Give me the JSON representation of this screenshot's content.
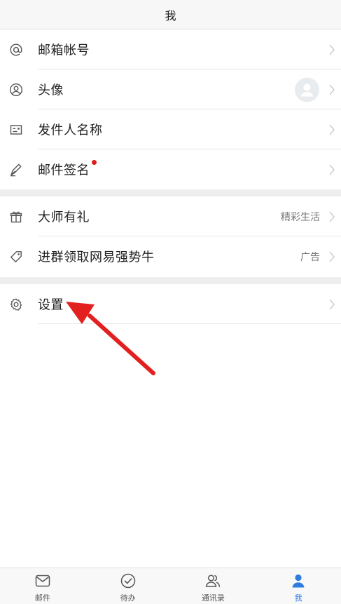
{
  "header": {
    "title": "我"
  },
  "groups": [
    {
      "items": [
        {
          "label": "邮箱帐号",
          "icon": "at-icon"
        },
        {
          "label": "头像",
          "icon": "user-circle-icon"
        },
        {
          "label": "发件人名称",
          "icon": "id-card-icon"
        },
        {
          "label": "邮件签名",
          "icon": "pen-icon",
          "badge": true
        }
      ]
    },
    {
      "items": [
        {
          "label": "大师有礼",
          "icon": "gift-icon",
          "value": "精彩生活"
        },
        {
          "label": "进群领取网易强势牛",
          "icon": "tag-icon",
          "value": "广告"
        }
      ]
    },
    {
      "items": [
        {
          "label": "设置",
          "icon": "gear-icon"
        }
      ]
    }
  ],
  "tabbar": {
    "tabs": [
      {
        "label": "邮件",
        "icon": "mail-icon"
      },
      {
        "label": "待办",
        "icon": "check-circle-icon"
      },
      {
        "label": "通讯录",
        "icon": "contacts-icon"
      },
      {
        "label": "我",
        "icon": "person-icon",
        "active": true
      }
    ]
  },
  "colors": {
    "accent": "#2f7de1",
    "badge": "#e31a1a",
    "annotation_arrow": "#e32020"
  }
}
